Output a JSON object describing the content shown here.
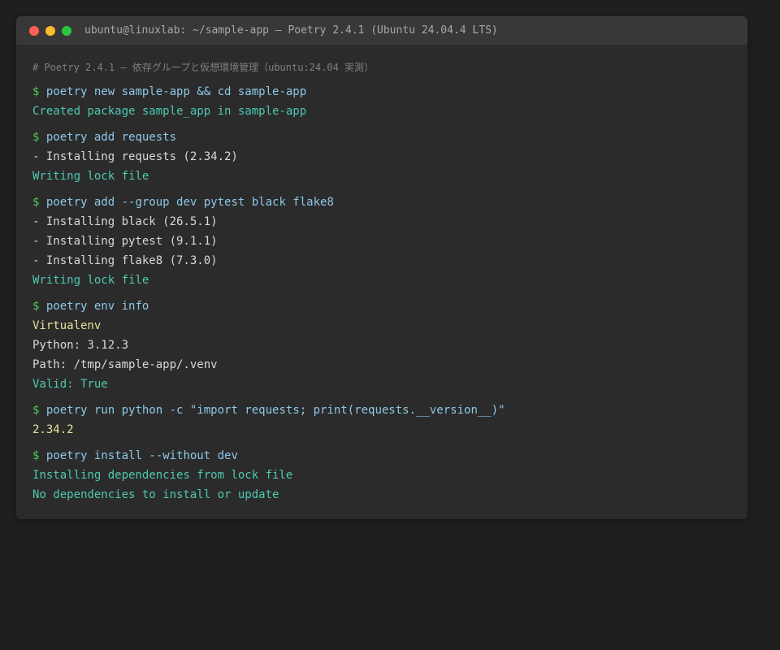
{
  "window": {
    "title": "ubuntu@linuxlab: ~/sample-app — Poetry 2.4.1 (Ubuntu 24.04.4 LTS)"
  },
  "terminal": {
    "comment": "# Poetry 2.4.1 — 依存グループと仮想環境管理（ubuntu:24.04 実測）",
    "prompt_symbol": "$",
    "blocks": [
      {
        "command": "poetry new sample-app && cd sample-app",
        "output": [
          {
            "text": "Created package sample_app in sample-app",
            "kind": "ok"
          }
        ]
      },
      {
        "command": "poetry add requests",
        "output": [
          {
            "text": "- Installing requests (2.34.2)",
            "kind": "out"
          },
          {
            "text": "Writing lock file",
            "kind": "ok"
          }
        ]
      },
      {
        "command": "poetry add --group dev pytest black flake8",
        "output": [
          {
            "text": "- Installing black (26.5.1)",
            "kind": "out"
          },
          {
            "text": "- Installing pytest (9.1.1)",
            "kind": "out"
          },
          {
            "text": "- Installing flake8 (7.3.0)",
            "kind": "out"
          },
          {
            "text": "Writing lock file",
            "kind": "ok"
          }
        ]
      },
      {
        "command": "poetry env info",
        "output": [
          {
            "text": "Virtualenv",
            "kind": "val"
          },
          {
            "text": "Python: 3.12.3",
            "kind": "out"
          },
          {
            "text": "Path: /tmp/sample-app/.venv",
            "kind": "out"
          },
          {
            "text": "Valid: True",
            "kind": "ok"
          }
        ]
      },
      {
        "command": "poetry run python -c \"import requests; print(requests.__version__)\"",
        "output": [
          {
            "text": "2.34.2",
            "kind": "val"
          }
        ]
      },
      {
        "command": "poetry install --without dev",
        "output": [
          {
            "text": "Installing dependencies from lock file",
            "kind": "ok"
          },
          {
            "text": "No dependencies to install or update",
            "kind": "ok"
          }
        ]
      }
    ]
  },
  "colors": {
    "window_bg": "#2b2b2b",
    "titlebar_bg": "#383838",
    "prompt": "#4ec94e",
    "command": "#8cc8e8",
    "output": "#d8d8d8",
    "success": "#4ec9b0",
    "value": "#e8e09a",
    "close": "#ff5f57",
    "minimize": "#febc2e",
    "maximize": "#28c840"
  }
}
